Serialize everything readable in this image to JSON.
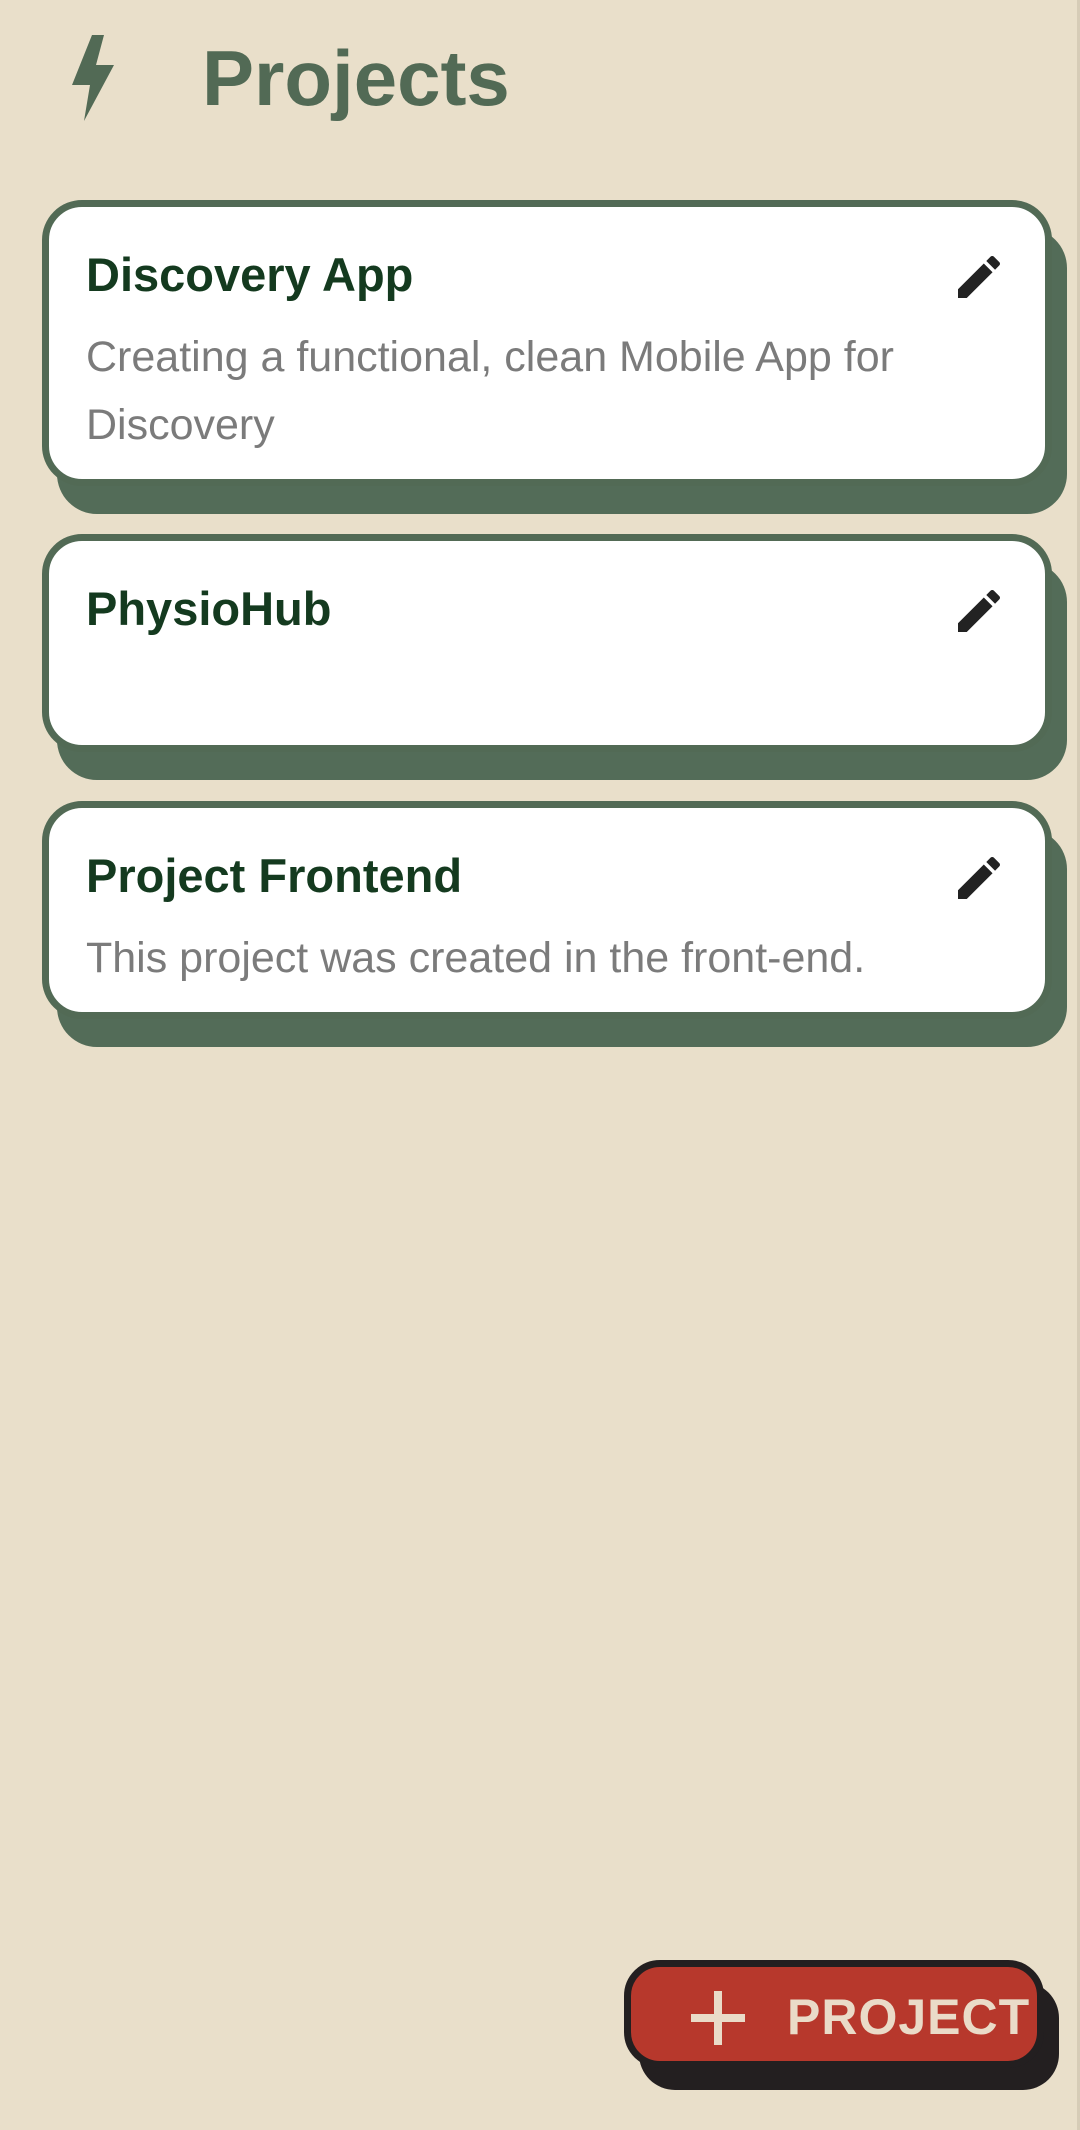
{
  "app": {
    "title": "Projects",
    "icon": "bolt-icon"
  },
  "colors": {
    "background": "#e9dfca",
    "accent": "#526a55",
    "card_title": "#143a1f",
    "card_desc": "#7b7b7b",
    "fab": "#b7382c",
    "fab_text": "#eadbc8"
  },
  "projects": [
    {
      "name": "Discovery App",
      "description": "Creating a functional, clean Mobile App for Discovery",
      "action_icon": "pencil-icon"
    },
    {
      "name": "PhysioHub",
      "description": "",
      "action_icon": "pencil-icon"
    },
    {
      "name": "Project Frontend",
      "description": "This project was created in the front-end.",
      "action_icon": "pencil-icon"
    }
  ],
  "fab": {
    "label": "PROJECT",
    "icon": "plus-icon"
  }
}
